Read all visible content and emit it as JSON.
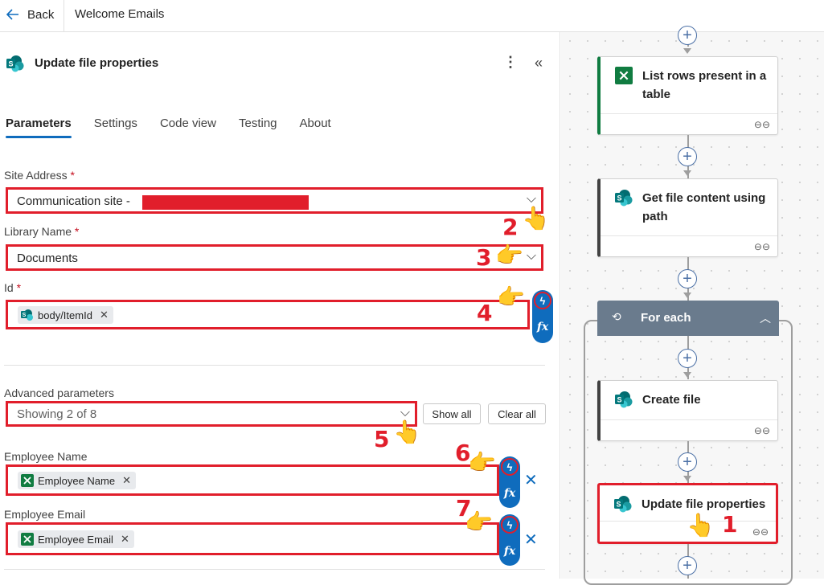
{
  "topbar": {
    "back_label": "Back",
    "flow_name": "Welcome Emails"
  },
  "panel": {
    "title": "Update file properties",
    "tabs": [
      {
        "label": "Parameters"
      },
      {
        "label": "Settings"
      },
      {
        "label": "Code view"
      },
      {
        "label": "Testing"
      },
      {
        "label": "About"
      }
    ],
    "site_address": {
      "label": "Site Address",
      "required": "*",
      "value": "Communication site -"
    },
    "library_name": {
      "label": "Library Name",
      "required": "*",
      "value": "Documents"
    },
    "id": {
      "label": "Id",
      "required": "*",
      "token": "body/ItemId"
    },
    "advanced": {
      "label": "Advanced parameters",
      "value": "Showing 2 of 8",
      "show_all": "Show all",
      "clear_all": "Clear all"
    },
    "employee_name": {
      "label": "Employee Name",
      "token": "Employee Name"
    },
    "employee_email": {
      "label": "Employee Email",
      "token": "Employee Email"
    }
  },
  "annotations": {
    "n1": "1",
    "n2": "2",
    "n3": "3",
    "n4": "4",
    "n5": "5",
    "n6": "6",
    "n7": "7"
  },
  "canvas": {
    "card1": "List rows present in a table",
    "card2": "Get file content using path",
    "foreach": "For each",
    "card3": "Create file",
    "card4": "Update file properties"
  },
  "icons": {
    "sharepoint": "sharepoint-icon",
    "excel": "excel-icon",
    "dynamic_content": "lightning-icon",
    "expression": "fx-icon"
  },
  "colors": {
    "accent": "#0f6cbd",
    "highlight": "#e11e2b",
    "excel": "#107c41",
    "sharepoint": "#038387"
  }
}
